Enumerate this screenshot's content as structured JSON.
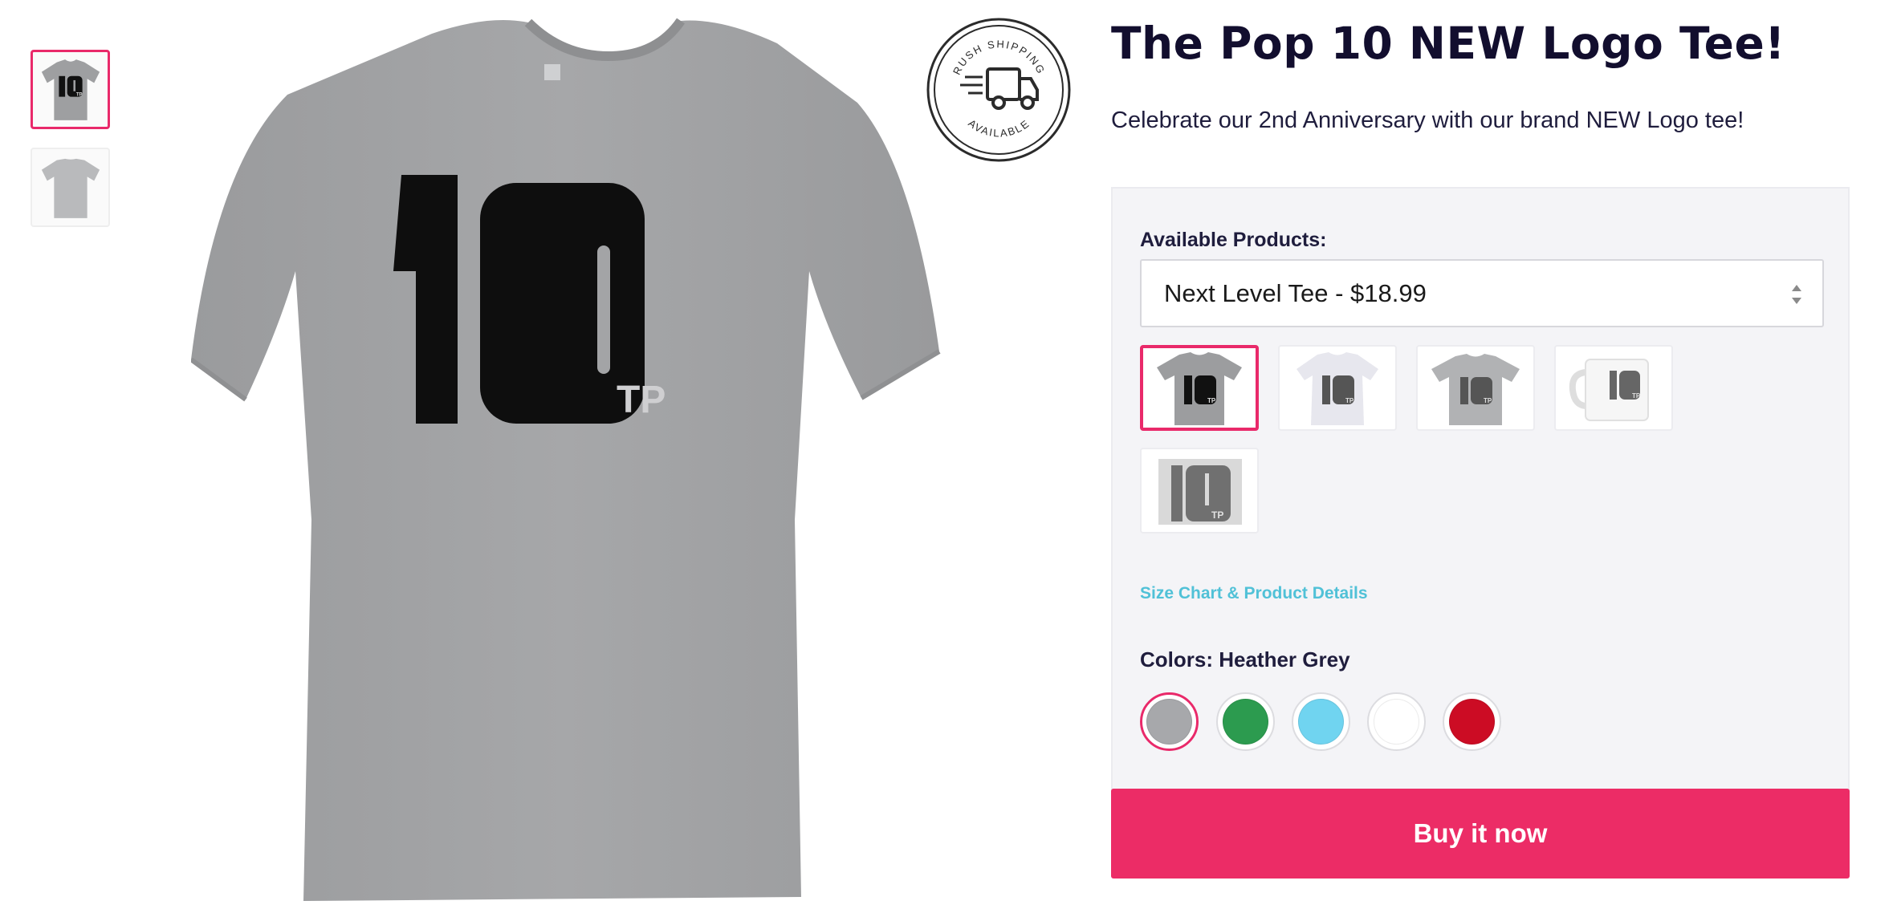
{
  "product": {
    "title": "The Pop 10 NEW Logo Tee!",
    "description": "Celebrate our 2nd Anniversary with our brand NEW Logo tee!",
    "logo_text": "10",
    "logo_sub": "TP"
  },
  "badge": {
    "top_text": "RUSH SHIPPING",
    "bottom_text": "AVAILABLE"
  },
  "options": {
    "products_label": "Available Products:",
    "selected_product": "Next Level Tee - $18.99",
    "product_tiles": [
      {
        "name": "Next Level Tee",
        "selected": true
      },
      {
        "name": "Ladies Tee",
        "selected": false
      },
      {
        "name": "Classic Tee",
        "selected": false
      },
      {
        "name": "Mug",
        "selected": false
      },
      {
        "name": "Poster",
        "selected": false
      }
    ],
    "size_chart_link": "Size Chart & Product Details",
    "colors_label": "Colors: Heather Grey",
    "colors": [
      {
        "name": "Heather Grey",
        "hex": "#a7a8ab",
        "selected": true
      },
      {
        "name": "Green",
        "hex": "#2c9b4f",
        "selected": false
      },
      {
        "name": "Light Blue",
        "hex": "#70d4f0",
        "selected": false
      },
      {
        "name": "White",
        "hex": "#ffffff",
        "selected": false
      },
      {
        "name": "Red",
        "hex": "#cc0c24",
        "selected": false
      }
    ]
  },
  "buy_button": "Buy it now",
  "theme": {
    "accent": "#ec2c66",
    "link": "#50c1d7",
    "shirt_grey": "#a2a3a5"
  }
}
